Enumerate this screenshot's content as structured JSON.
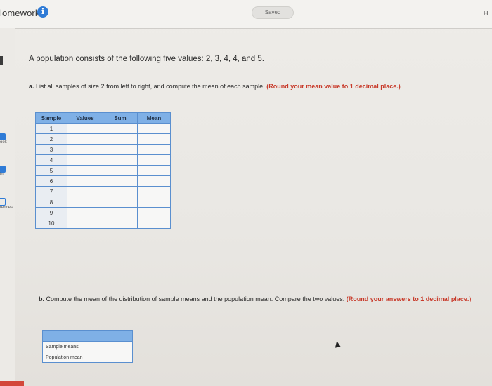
{
  "header": {
    "title": "lomework",
    "saved": "Saved",
    "corner": "H"
  },
  "sidebar": {
    "items": [
      {
        "label": "ook",
        "icon": "book-icon"
      },
      {
        "label": "int",
        "icon": "print-icon"
      },
      {
        "label": "rences",
        "icon": "references-icon"
      }
    ]
  },
  "content": {
    "intro": "A population consists of the following five values: 2, 3, 4, 4, and 5.",
    "part_a": {
      "label": "a.",
      "text": "List all samples of size 2 from left to right, and compute the mean of each sample.",
      "note": "(Round your mean value to 1 decimal place.)"
    },
    "sample_table": {
      "headers": [
        "Sample",
        "Values",
        "Sum",
        "Mean"
      ],
      "rows": [
        "1",
        "2",
        "3",
        "4",
        "5",
        "6",
        "7",
        "8",
        "9",
        "10"
      ]
    },
    "part_b": {
      "label": "b.",
      "text": "Compute the mean of the distribution of sample means and the population mean. Compare the two values.",
      "note": "(Round your answers to 1 decimal place.)"
    },
    "means_table": {
      "rows": [
        "Sample means",
        "Population mean"
      ]
    }
  },
  "colors": {
    "accent": "#2f7bd6",
    "table_header": "#7fb0e6",
    "instruction_red": "#c83a2a"
  }
}
